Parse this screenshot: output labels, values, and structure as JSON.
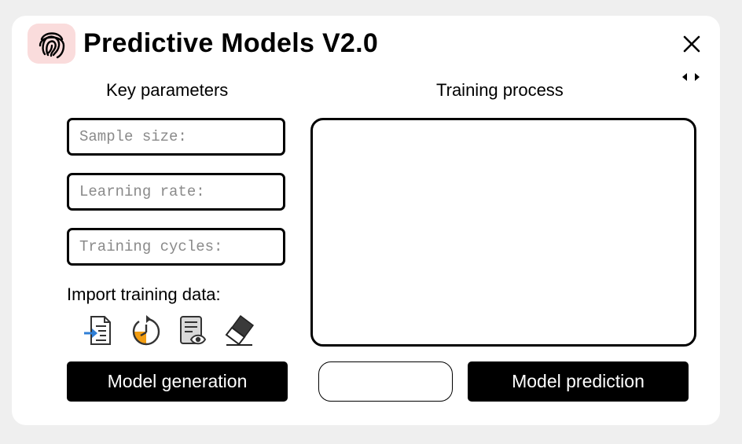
{
  "app": {
    "title": "Predictive Models V2.0",
    "logo_icon": "fingerprint-icon",
    "logo_bg_color": "#fadcdc"
  },
  "window_controls": {
    "close_icon": "close-icon",
    "resize_icon": "resize-arrows-icon"
  },
  "left_panel": {
    "title": "Key parameters",
    "inputs": [
      {
        "placeholder": "Sample size:",
        "value": ""
      },
      {
        "placeholder": "Learning rate:",
        "value": ""
      },
      {
        "placeholder": "Training cycles:",
        "value": ""
      }
    ],
    "import_label": "Import training data:",
    "tools": [
      {
        "icon": "import-file-icon"
      },
      {
        "icon": "history-icon"
      },
      {
        "icon": "view-document-icon"
      },
      {
        "icon": "eraser-icon"
      }
    ],
    "generate_button": "Model generation"
  },
  "right_panel": {
    "title": "Training process",
    "status_text": "",
    "predict_button": "Model prediction"
  },
  "colors": {
    "background": "#efefef",
    "window": "#ffffff",
    "button": "#000000",
    "button_text": "#ffffff",
    "accent_orange": "#f29d12",
    "accent_blue": "#2f7fd6"
  }
}
